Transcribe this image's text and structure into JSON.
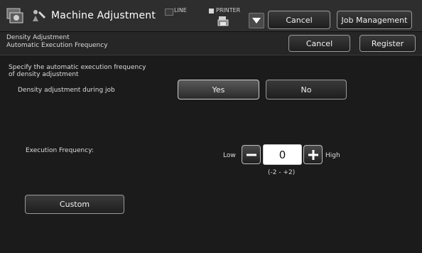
{
  "header": {
    "title": "Machine Adjustment",
    "status_line": "LINE",
    "status_printer": "PRINTER",
    "cancel_label": "Cancel",
    "job_management_label": "Job Management"
  },
  "subheader": {
    "breadcrumb_line1": "Density Adjustment",
    "breadcrumb_line2": "Automatic Execution Frequency",
    "cancel_label": "Cancel",
    "register_label": "Register"
  },
  "main": {
    "instruction_line1": "Specify the automatic execution frequency",
    "instruction_line2": "of density adjustment",
    "density_during_job_label": "Density adjustment during job",
    "yes_label": "Yes",
    "no_label": "No",
    "selected_option": "Yes",
    "execution_frequency_label": "Execution Frequency:",
    "low_label": "Low",
    "high_label": "High",
    "frequency_value": "0",
    "range_label": "(-2 - +2)",
    "custom_label": "Custom"
  },
  "colors": {
    "background": "#1b1b1b",
    "header_background": "#2e2e2e",
    "text": "#e6e6e6",
    "button_border": "#9a9a9a",
    "value_box": "#ffffff"
  },
  "icons": {
    "app_logo": "settings-logo-icon",
    "adjustment": "wrench-person-icon",
    "printer": "printer-icon",
    "dropdown": "triangle-down-icon",
    "minus": "minus-icon",
    "plus": "plus-icon"
  }
}
